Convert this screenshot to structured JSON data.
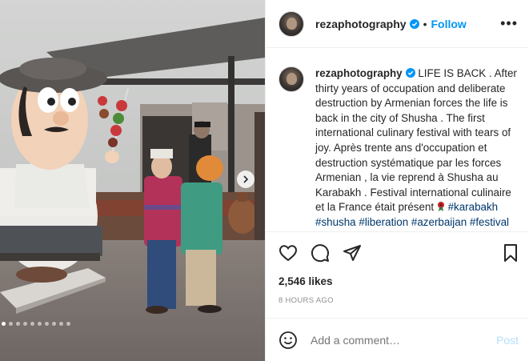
{
  "post": {
    "username": "rezaphotography",
    "follow_label": "Follow",
    "bullet": "•",
    "more_label": "•••",
    "caption_user": "rezaphotography",
    "caption_text": " LIFE IS BACK . After thirty years of occupation and deliberate destruction by Armenian forces the life is back in the city of Shusha . The first international culinary festival with tears of joy. Après trente ans d'occupation et destruction systématique par les forces Armenian , la vie reprend à Shusha au Karabakh . Festival international culinaire et la France était présent ",
    "hashtags": [
      "#karabakh",
      "#shusha",
      "#liberation",
      "#azerbaijan",
      "#festival"
    ],
    "likes": "2,546 likes",
    "timestamp": "8 HOURS AGO",
    "comment_placeholder": "Add a comment…",
    "post_button": "Post"
  },
  "carousel": {
    "slide_count": 10,
    "active_index": 0
  },
  "icons": {
    "verified": "verified-badge-icon",
    "like": "heart-icon",
    "comment": "comment-icon",
    "share": "share-icon",
    "save": "bookmark-icon",
    "emoji": "emoji-icon",
    "next": "chevron-right-icon",
    "rosette": "rosette-icon"
  },
  "colors": {
    "accent": "#0095f6",
    "hashtag": "#00376b",
    "muted": "#8e8e8e",
    "post_disabled": "#b2dffc",
    "text": "#262626"
  }
}
